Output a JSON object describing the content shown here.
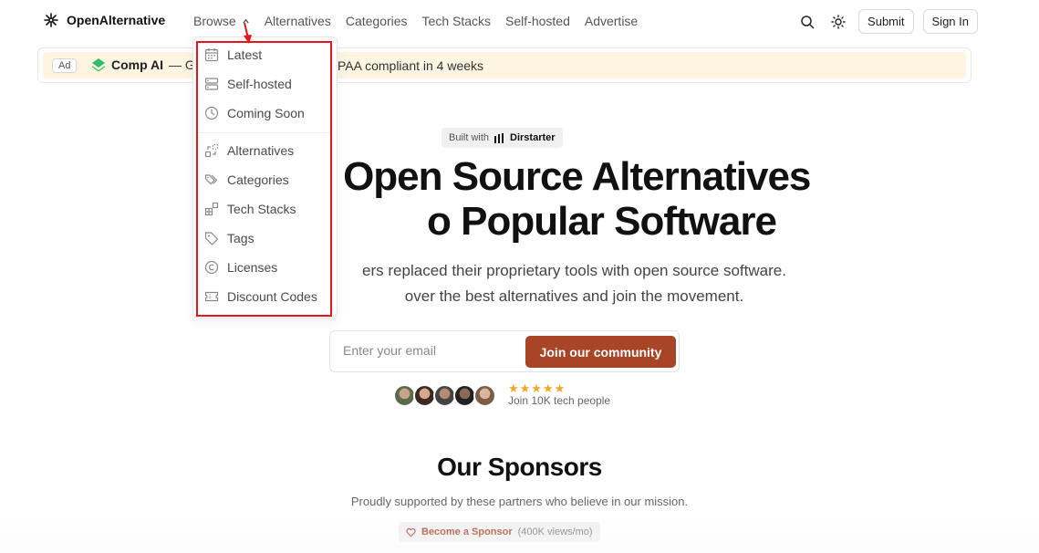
{
  "header": {
    "logo_text": "OpenAlternative",
    "nav": [
      {
        "label": "Browse"
      },
      {
        "label": "Alternatives"
      },
      {
        "label": "Categories"
      },
      {
        "label": "Tech Stacks"
      },
      {
        "label": "Self-hosted"
      },
      {
        "label": "Advertise"
      }
    ],
    "submit_label": "Submit",
    "signin_label": "Sign In"
  },
  "ad": {
    "badge": "Ad",
    "brand": "Comp AI",
    "text_fragment": "— Ge",
    "text_tail": "PAA compliant in 4 weeks"
  },
  "dropdown": {
    "items": [
      {
        "label": "Latest",
        "icon": "calendar-icon"
      },
      {
        "label": "Self-hosted",
        "icon": "server-icon"
      },
      {
        "label": "Coming Soon",
        "icon": "clock-icon"
      },
      {
        "label": "Alternatives",
        "icon": "alternatives-icon"
      },
      {
        "label": "Categories",
        "icon": "tags-icon"
      },
      {
        "label": "Tech Stacks",
        "icon": "blocks-icon"
      },
      {
        "label": "Tags",
        "icon": "tag-icon"
      },
      {
        "label": "Licenses",
        "icon": "copyright-icon"
      },
      {
        "label": "Discount Codes",
        "icon": "ticket-icon"
      }
    ]
  },
  "hero": {
    "built_with": "Built with",
    "built_brand": "Dirstarter",
    "title_line1": "D      r Open Source Alternatives",
    "title_line2": "o Popular Software",
    "subtitle_line1": "ers replaced their proprietary tools with open source software.",
    "subtitle_line2": "over the best alternatives and join the movement."
  },
  "signup": {
    "placeholder": "Enter your email",
    "button_label": "Join our community",
    "stars": "★★★★★",
    "social_text": "Join 10K tech people"
  },
  "sponsors": {
    "title": "Our Sponsors",
    "subtitle": "Proudly supported by these partners who believe in our mission.",
    "become_label": "Become a Sponsor",
    "become_views": "(400K views/mo)"
  },
  "colors": {
    "accent": "#a84527",
    "ad_background": "#fdf5e2",
    "highlight": "#e8141c",
    "stars": "#f5a623"
  }
}
